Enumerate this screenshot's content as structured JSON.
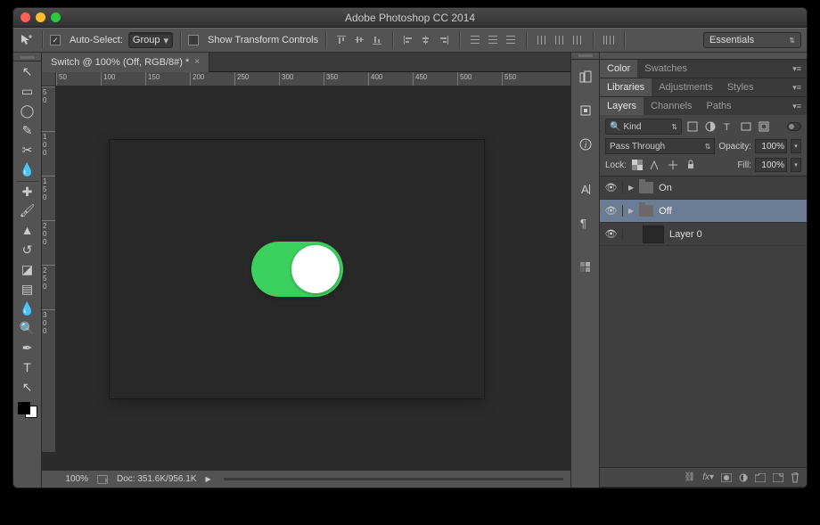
{
  "window": {
    "title": "Adobe Photoshop CC 2014"
  },
  "options": {
    "auto_select_label": "Auto-Select:",
    "auto_select_checked": true,
    "group_mode": "Group",
    "show_transform_label": "Show Transform Controls",
    "show_transform_checked": false,
    "workspace": "Essentials"
  },
  "document": {
    "tab_title": "Switch @ 100% (Off, RGB/8#) *",
    "zoom": "100%",
    "doc_size": "Doc: 351.6K/956.1K",
    "ruler_h": [
      "50",
      "100",
      "150",
      "200",
      "250",
      "300",
      "350",
      "400",
      "450",
      "500",
      "550"
    ],
    "ruler_v": [
      "5 0",
      "1 0 0",
      "1 5 0",
      "2 0 0",
      "2 5 0",
      "3 0 0"
    ],
    "switch_color": "#3bcf5e"
  },
  "panel_color": {
    "tabs": [
      "Color",
      "Swatches"
    ],
    "active": 0
  },
  "panel_lib": {
    "tabs": [
      "Libraries",
      "Adjustments",
      "Styles"
    ],
    "active": 0
  },
  "panel_layers": {
    "tabs": [
      "Layers",
      "Channels",
      "Paths"
    ],
    "active": 0,
    "kind": "Kind",
    "blend_mode": "Pass Through",
    "opacity_label": "Opacity:",
    "opacity": "100%",
    "lock_label": "Lock:",
    "fill_label": "Fill:",
    "fill": "100%",
    "layers": [
      {
        "name": "On",
        "type": "group",
        "visible": true,
        "selected": false
      },
      {
        "name": "Off",
        "type": "group",
        "visible": true,
        "selected": true
      },
      {
        "name": "Layer 0",
        "type": "layer",
        "visible": true,
        "selected": false
      }
    ]
  },
  "dock_icons_a": [
    "history-icon",
    "properties-icon",
    "info-icon"
  ],
  "dock_icons_b": [
    "character-icon",
    "paragraph-icon"
  ],
  "dock_icons_c": [
    "swatches-icon"
  ],
  "tools": [
    "move-tool",
    "marquee-tool",
    "lasso-tool",
    "quick-select-tool",
    "crop-tool",
    "eyedropper-tool",
    "healing-brush-tool",
    "brush-tool",
    "clone-stamp-tool",
    "history-brush-tool",
    "eraser-tool",
    "gradient-tool",
    "blur-tool",
    "dodge-tool",
    "pen-tool",
    "type-tool",
    "path-select-tool"
  ]
}
